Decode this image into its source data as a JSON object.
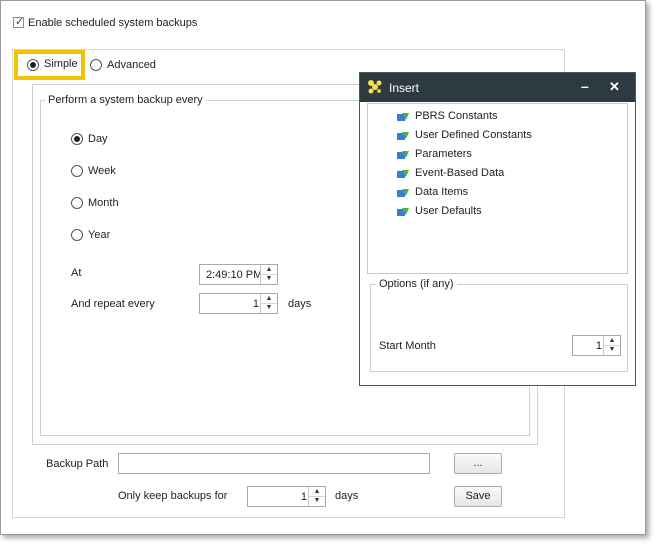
{
  "enable_backups": {
    "label": "Enable scheduled system backups",
    "checked": true
  },
  "mode_tabs": {
    "simple": "Simple",
    "advanced": "Advanced",
    "selected": "simple"
  },
  "schedule": {
    "group_label": "Perform a system backup every",
    "options": [
      "Day",
      "Week",
      "Month",
      "Year"
    ],
    "selected": "Day",
    "at_label": "At",
    "at_value": "2:49:10 PM",
    "repeat_label": "And repeat every",
    "repeat_value": "1",
    "repeat_unit": "days"
  },
  "backup": {
    "path_label": "Backup Path",
    "path_value": "",
    "browse_label": "...",
    "keep_label": "Only keep backups for",
    "keep_value": "1",
    "keep_unit": "days",
    "save_label": "Save"
  },
  "insert_dialog": {
    "title": "Insert",
    "minimize": "–",
    "close": "✕",
    "items": [
      "PBRS Constants",
      "User Defined Constants",
      "Parameters",
      "Event-Based Data",
      "Data Items",
      "User Defaults"
    ],
    "options_label": "Options (if any)",
    "start_month_label": "Start Month",
    "start_month_value": "1"
  },
  "colors": {
    "highlight": "#f2c300",
    "title_bar": "#2d3a42"
  }
}
